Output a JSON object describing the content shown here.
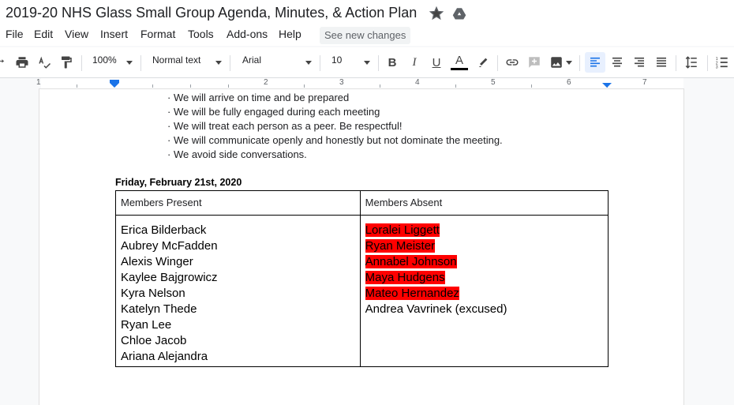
{
  "doc": {
    "title": "2019-20 NHS Glass Small Group Agenda, Minutes, & Action Plan"
  },
  "menu": [
    "File",
    "Edit",
    "View",
    "Insert",
    "Format",
    "Tools",
    "Add-ons",
    "Help"
  ],
  "see_new_changes": "See new changes",
  "toolbar": {
    "zoom": "100%",
    "style": "Normal text",
    "font": "Arial",
    "size": "10"
  },
  "ruler": {
    "numbers": [
      "1",
      "2",
      "3",
      "4",
      "5",
      "6",
      "7"
    ]
  },
  "bullets": [
    "· We will arrive on time and be prepared",
    "· We will be fully engaged during each meeting",
    "· We will treat each person as a peer.  Be respectful!",
    "· We will communicate openly and honestly but not dominate the meeting.",
    "· We avoid side conversations."
  ],
  "meeting": {
    "date": "Friday, February 21st, 2020",
    "present_header": "Members Present",
    "absent_header": "Members Absent",
    "present": [
      "Erica Bilderback",
      "Aubrey McFadden",
      "Alexis Winger",
      "Kaylee Bajgrowicz",
      "Kyra Nelson",
      "Katelyn Thede",
      "Ryan Lee",
      "Chloe Jacob",
      "Ariana Alejandra"
    ],
    "absent_highlighted": [
      "Loralei Liggett",
      "Ryan Meister",
      "Annabel Johnson",
      "Maya Hudgens",
      "Mateo Hernandez"
    ],
    "absent_other": [
      "Andrea Vavrinek (excused)"
    ]
  },
  "colors": {
    "highlight": "#ff0000",
    "accent": "#1a73e8"
  },
  "icons": [
    "star-icon",
    "drive-icon",
    "redo-icon",
    "print-icon",
    "spellcheck-icon",
    "paint-format-icon",
    "bold-icon",
    "italic-icon",
    "underline-icon",
    "text-color-icon",
    "highlight-icon",
    "link-icon",
    "comment-icon",
    "image-icon",
    "align-left-icon",
    "align-center-icon",
    "align-right-icon",
    "justify-icon",
    "line-spacing-icon",
    "numbered-list-icon"
  ]
}
